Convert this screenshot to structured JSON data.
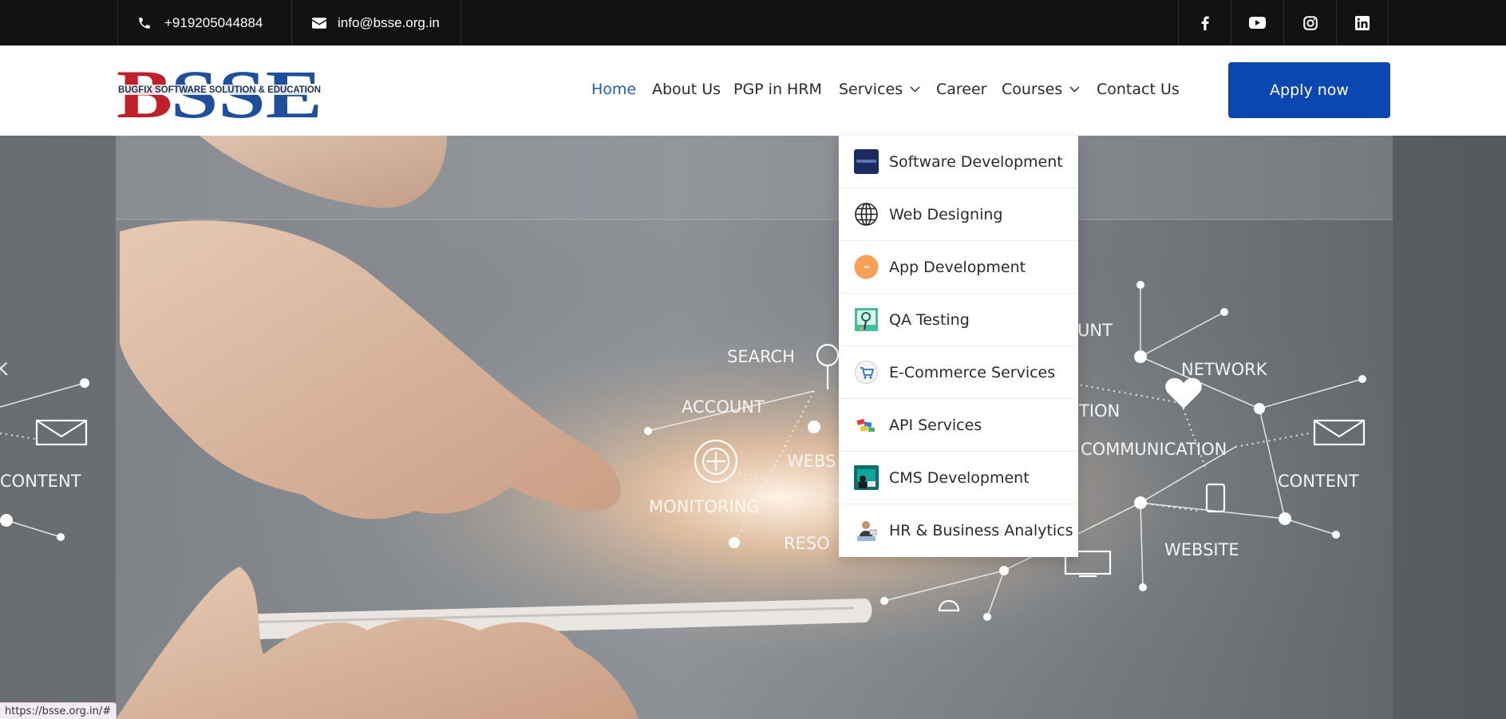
{
  "topbar": {
    "phone": "+919205044884",
    "email": "info@bsse.org.in",
    "social": [
      "facebook-icon",
      "youtube-icon",
      "instagram-icon",
      "linkedin-icon"
    ]
  },
  "logo": {
    "text": "BSSE",
    "tagline": "BUGFIX SOFTWARE SOLUTION & EDUCATION"
  },
  "nav": {
    "items": [
      "Home",
      "About Us",
      "PGP in HRM",
      "Services",
      "Career",
      "Courses",
      "Contact Us"
    ],
    "active": "Home"
  },
  "apply_label": "Apply now",
  "services_menu": {
    "items": [
      {
        "label": "Software Development",
        "icon": "software-development-icon"
      },
      {
        "label": "Web Designing",
        "icon": "globe-icon"
      },
      {
        "label": "App Development",
        "icon": "app-development-icon"
      },
      {
        "label": "QA Testing",
        "icon": "qa-testing-icon"
      },
      {
        "label": "E-Commerce Services",
        "icon": "shopping-cart-icon"
      },
      {
        "label": "API Services",
        "icon": "api-services-icon"
      },
      {
        "label": "CMS Development",
        "icon": "cms-development-icon"
      },
      {
        "label": "HR & Business Analytics",
        "icon": "hr-analytics-icon"
      }
    ]
  },
  "hero": {
    "labels": [
      "SEARCH",
      "ACCOUNT",
      "WEBS",
      "MONITORING",
      "RESO",
      "UNT",
      "NETWORK",
      "TION",
      "COMMUNICATION",
      "CONTENT",
      "WEBSITE",
      "CONTENT",
      "K"
    ]
  },
  "statusbar": {
    "url": "https://bsse.org.in/#"
  },
  "colors": {
    "topbar_bg": "#121212",
    "accent_blue": "#0a47b1",
    "active_link": "#1e5fb6",
    "logo_red": "#c0202a",
    "logo_blue": "#1d4f9b"
  }
}
